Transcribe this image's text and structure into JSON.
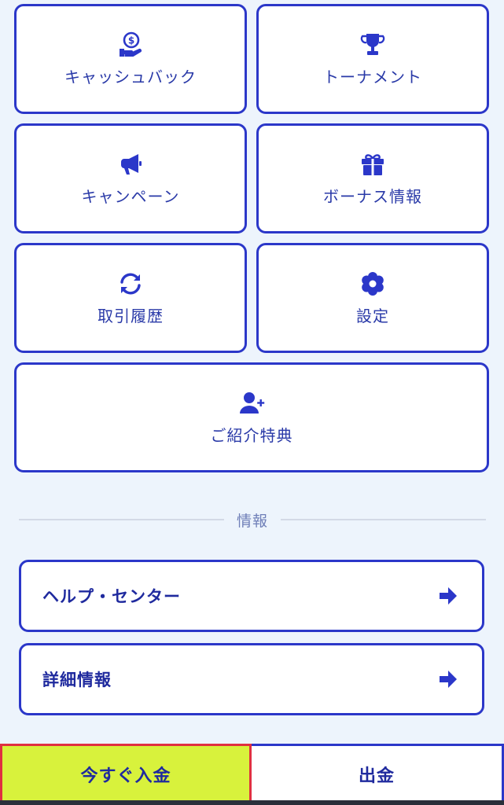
{
  "menu": {
    "tiles": [
      {
        "label": "キャッシュバック",
        "icon": "cashback-icon"
      },
      {
        "label": "トーナメント",
        "icon": "trophy-icon"
      },
      {
        "label": "キャンペーン",
        "icon": "megaphone-icon"
      },
      {
        "label": "ボーナス情報",
        "icon": "gift-icon"
      },
      {
        "label": "取引履歴",
        "icon": "refresh-icon"
      },
      {
        "label": "設定",
        "icon": "gear-icon"
      },
      {
        "label": "ご紹介特典",
        "icon": "add-user-icon"
      }
    ]
  },
  "info": {
    "section_title": "情報",
    "links": [
      {
        "label": "ヘルプ・センター",
        "icon": "arrow-right-icon"
      },
      {
        "label": "詳細情報",
        "icon": "arrow-right-icon"
      }
    ]
  },
  "bottom": {
    "deposit_label": "今すぐ入金",
    "withdraw_label": "出金"
  },
  "colors": {
    "accent": "#2b37c9",
    "deposit": "#d8f23c",
    "background": "#edf4fc"
  }
}
